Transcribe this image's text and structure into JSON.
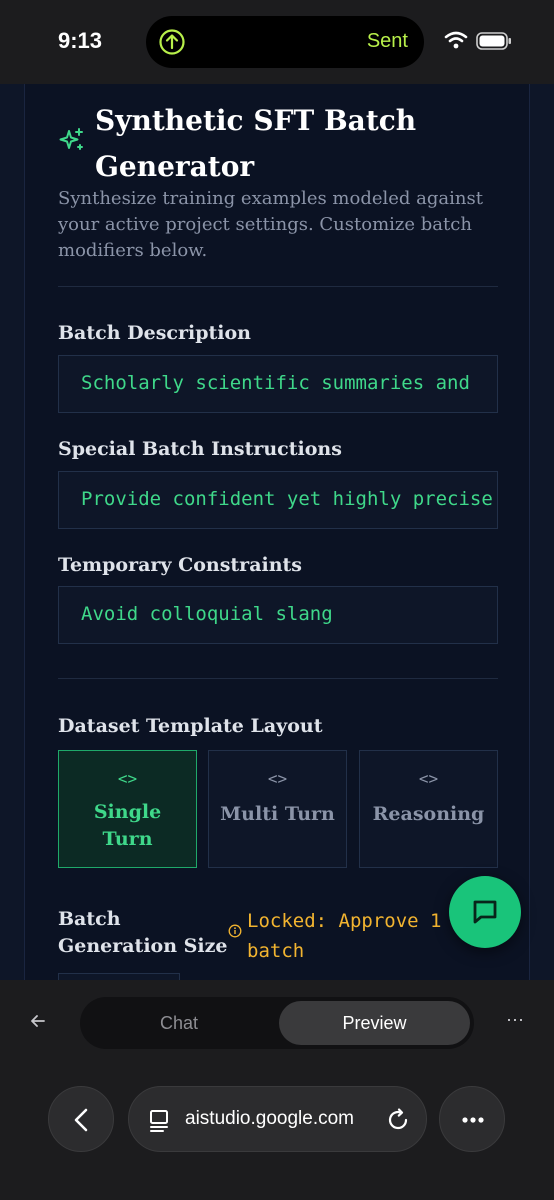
{
  "status_bar": {
    "time": "9:13",
    "activity_label": "Sent"
  },
  "page": {
    "title": "Synthetic SFT Batch Generator",
    "subtitle": "Synthesize training examples modeled against your active project settings. Customize batch modifiers below.",
    "fields": [
      {
        "label": "Batch Description",
        "value": "Scholarly scientific summaries and"
      },
      {
        "label": "Special Batch Instructions",
        "value": "Provide confident yet highly precise"
      },
      {
        "label": "Temporary Constraints",
        "value": "Avoid colloquial slang"
      }
    ],
    "template_layout": {
      "label": "Dataset Template Layout",
      "code_glyph": "<>",
      "options": [
        {
          "label": "Single Turn",
          "selected": true
        },
        {
          "label": "Multi Turn",
          "selected": false
        },
        {
          "label": "Reasoning",
          "selected": false
        }
      ]
    },
    "batch_size": {
      "label": "Batch Generation Size",
      "lock_message": "Locked: Approve 1 batch"
    }
  },
  "browser": {
    "tabs": [
      "Chat",
      "Preview"
    ],
    "active_tab": "Preview",
    "url": "aistudio.google.com"
  },
  "colors": {
    "accent": "#3fd88a",
    "warning": "#f2b430",
    "fab": "#19c47a",
    "activity": "#b8f04a"
  },
  "icons": [
    "upload-icon",
    "wifi-icon",
    "battery-icon",
    "sparkle-icon",
    "code-icon",
    "info-icon",
    "chat-bubble-icon",
    "back-arrow-icon",
    "more-icon",
    "tabs-icon",
    "reload-icon",
    "chevron-left-icon",
    "ellipsis-icon"
  ]
}
